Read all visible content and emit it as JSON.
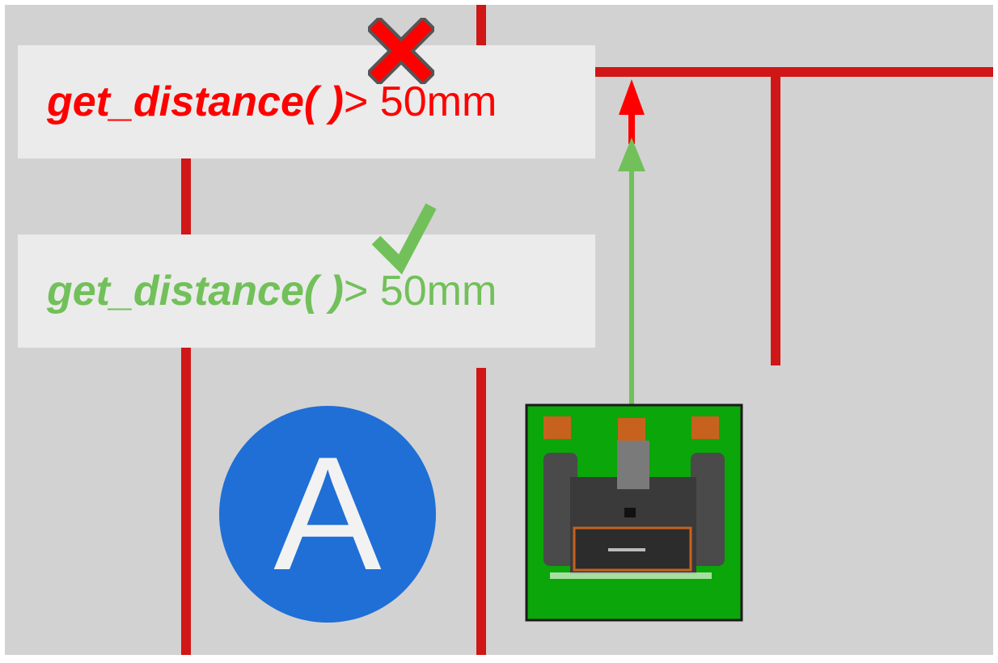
{
  "colors": {
    "floor": "#d2d2d2",
    "wall": "#d01616",
    "fail": "#ff0000",
    "pass": "#72c05a",
    "box": "#ebebeb",
    "badge": "#1f6fd6",
    "robot_pad": "#0aa60a"
  },
  "checks": [
    {
      "status": "fail",
      "function": "get_distance( )",
      "operator_value": " > 50mm",
      "mark_icon": "cross-icon"
    },
    {
      "status": "pass",
      "function": "get_distance( )",
      "operator_value": " > 50mm",
      "mark_icon": "check-icon"
    }
  ],
  "start_marker": {
    "letter": "A"
  },
  "robot": {
    "icon": "robot-icon"
  }
}
